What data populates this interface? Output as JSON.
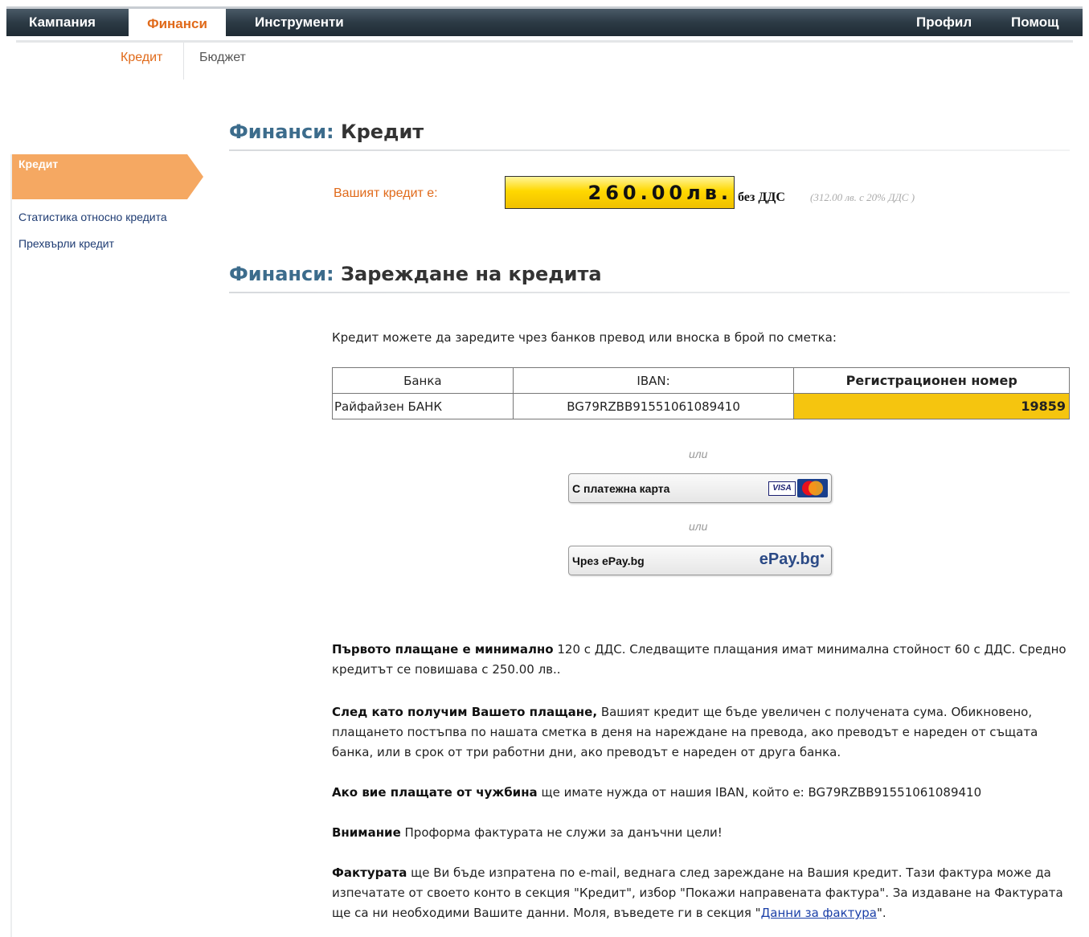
{
  "topnav": {
    "campaign": "Кампания",
    "finance": "Финанси",
    "tools": "Инструменти",
    "profile": "Профил",
    "help": "Помощ"
  },
  "subnav": {
    "credit": "Кредит",
    "budget": "Бюджет"
  },
  "sidebar": {
    "active": "Кредит",
    "items": [
      "Статистика относно кредита",
      "Прехвърли кредит"
    ]
  },
  "credit_section": {
    "title_prefix": "Финанси:",
    "title": "Кредит",
    "label": "Вашият кредит е:",
    "value": "260.00лв.",
    "no_vat": "без ДДС",
    "with_vat": "(312.00 лв. с 20% ДДС )"
  },
  "topup_section": {
    "title_prefix": "Финанси:",
    "title": "Зареждане на кредита",
    "intro": "Кредит можете да заредите чрез банков превод или вноска в брой по сметка:",
    "table": {
      "headers": [
        "Банка",
        "IBAN:",
        "Регистрационен номер"
      ],
      "rows": [
        [
          "Райфайзен БАНК",
          "BG79RZBB91551061089410",
          "19859"
        ]
      ]
    },
    "or": "или",
    "card_button": "С платежна карта",
    "card_logo_visa": "VISA",
    "epay_button": "Чрез ePay.bg",
    "epay_logo": "ePay.bg"
  },
  "paragraphs": {
    "p1_bold": "Първото плащане е минимално",
    "p1_text": " 120 с ДДС. Следващите плащания имат минимална стойност 60 с ДДС. Средно кредитът се повишава с 250.00 лв..",
    "p2_bold": "След като получим Вашето плащане,",
    "p2_text": " Вашият кредит ще бъде увеличен с получената сума. Обикновено, плащането постъпва по нашата сметка в деня на нареждане на превода, ако преводът е нареден от същата банка, или в срок от три работни дни, ако преводът е нареден от друга банка.",
    "p3_bold": "Ако вие плащате от чужбина",
    "p3_text": " ще имате нужда от нашия IBAN, който е: BG79RZBB91551061089410",
    "p4_bold": "Внимание",
    "p4_text": " Проформа фактурата не служи за данъчни цели!",
    "p5_bold": "Фактурата",
    "p5_text": " ще Ви бъде изпратена по e-mail, веднага след зареждане на Вашия кредит. Тази фактура може да изпечатате от своето конто в секция \"Кредит\", избор \"Покажи направената фактура\". За издаване на Фактурата ще са ни необходими Вашите данни. Моля, въведете ги в секция \"",
    "p5_link": "Данни за фактура",
    "p5_end": "\"."
  },
  "colors": {
    "accent_orange": "#e06a1a",
    "nav_dark": "#2c3a45",
    "sidebar_active": "#f5a862",
    "credit_yellow": "#ffd800",
    "reg_yellow": "#f5c50f",
    "title_blue": "#3c6c8c"
  }
}
